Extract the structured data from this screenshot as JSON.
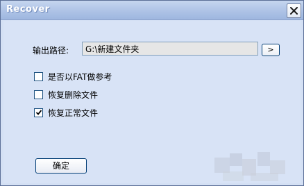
{
  "window": {
    "title": "Recover"
  },
  "output": {
    "label": "输出路径:",
    "value": "G:\\新建文件夹",
    "browse_label": ">"
  },
  "options": [
    {
      "label": "是否以FAT做参考",
      "checked": false
    },
    {
      "label": "恢复删除文件",
      "checked": false
    },
    {
      "label": "恢复正常文件",
      "checked": true
    }
  ],
  "buttons": {
    "ok_label": "确定"
  },
  "icons": {
    "close": "close-icon",
    "checkmark": "checkmark-icon"
  },
  "colors": {
    "titlebar": "#aec3e6",
    "dialog_background": "#d8e3f6",
    "button_border": "#003c74",
    "input_background": "#e6e6e6"
  }
}
